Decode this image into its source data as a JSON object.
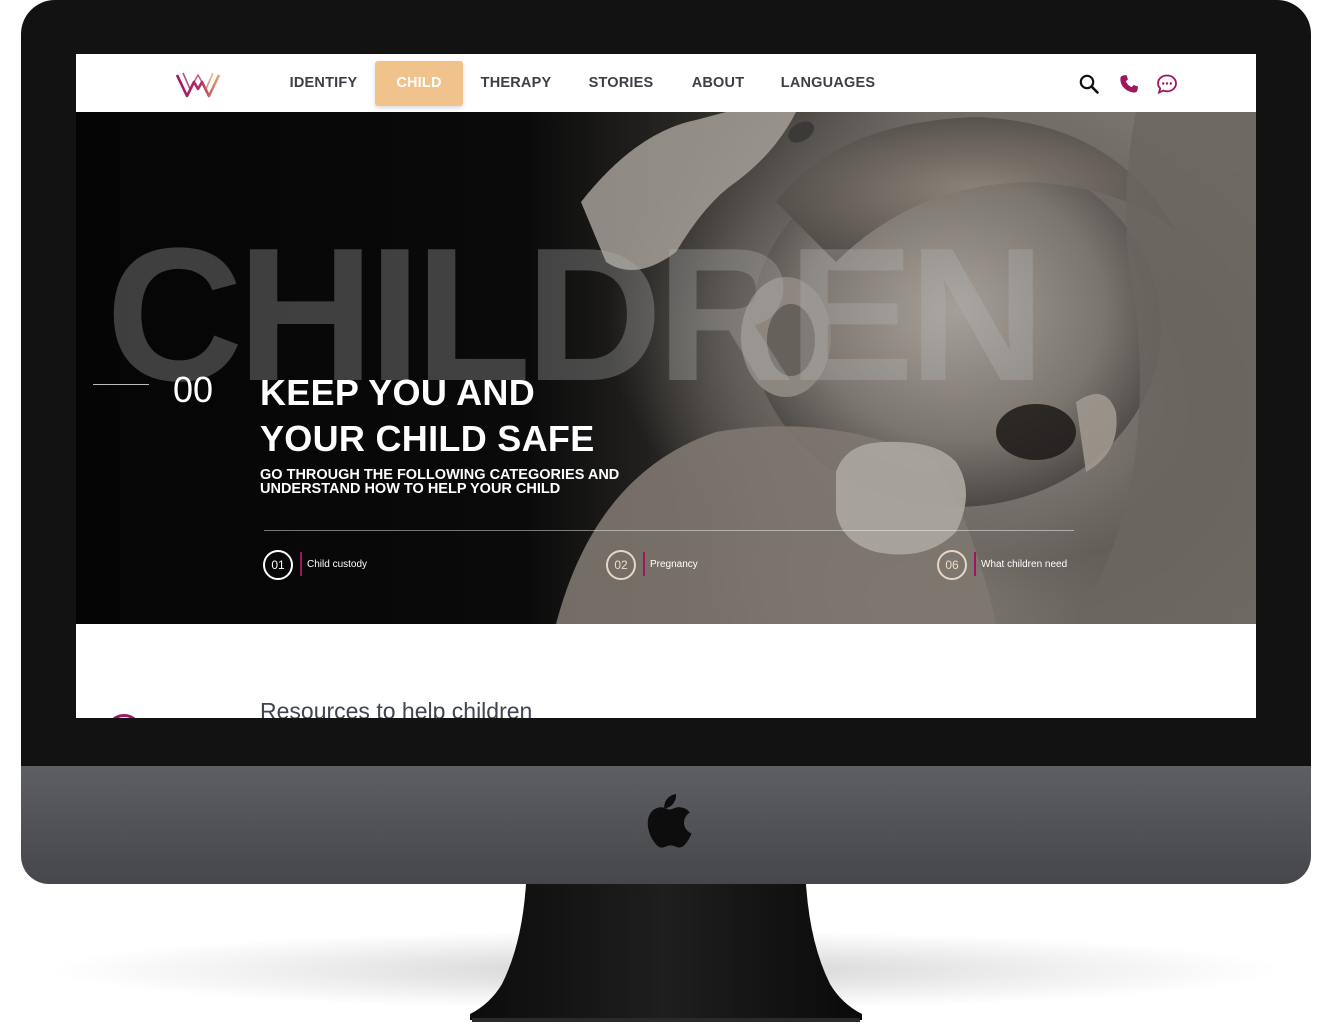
{
  "nav": {
    "items": [
      {
        "label": "IDENTIFY"
      },
      {
        "label": "CHILD"
      },
      {
        "label": "THERAPY"
      },
      {
        "label": "STORIES"
      },
      {
        "label": "ABOUT"
      },
      {
        "label": "LANGUAGES"
      }
    ],
    "active": "CHILD",
    "icons": [
      "search-icon",
      "phone-icon",
      "chat-icon"
    ],
    "active_color": "#F0C28C",
    "accent_color": "#A0165D"
  },
  "hero": {
    "background_word": "CHILDREN",
    "index": "00",
    "headline_line1": "KEEP YOU AND",
    "headline_line2": "YOUR CHILD SAFE",
    "sub_line1": "GO THROUGH THE FOLLOWING CATEGORIES AND",
    "sub_line2": "UNDERSTAND HOW TO HELP YOUR CHILD",
    "categories": [
      {
        "number": "01",
        "label": "Child custody"
      },
      {
        "number": "02",
        "label": "Pregnancy"
      },
      {
        "number": "06",
        "label": "What children need"
      }
    ]
  },
  "resources": {
    "title": "Resources to help children"
  }
}
